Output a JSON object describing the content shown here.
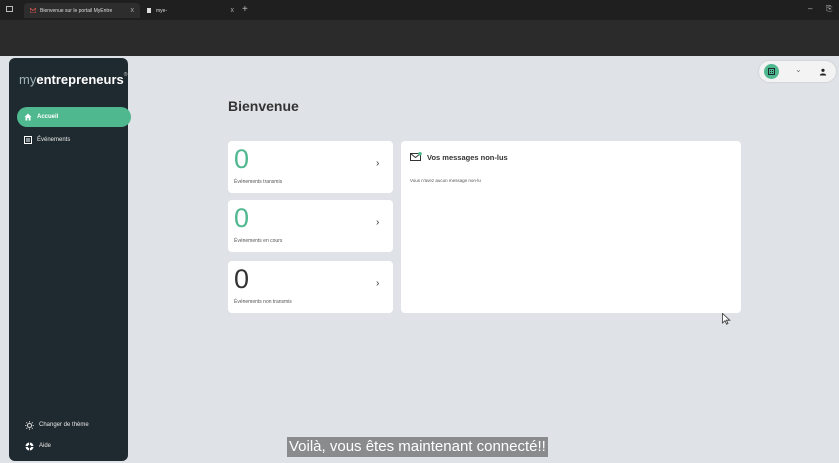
{
  "browser": {
    "tabs": [
      {
        "title": "Bienvenue sur le portail MyEntre",
        "active": true
      },
      {
        "title": "mye-",
        "active": false
      }
    ],
    "new_tab_label": "+",
    "close_label": "x",
    "minimize_label": "–",
    "restore_label": "⎘"
  },
  "brand": {
    "prefix": "my",
    "name": "entrepreneurs",
    "mark": "®"
  },
  "sidebar": {
    "items": [
      {
        "label": "Accueil",
        "icon": "home-icon",
        "active": true
      },
      {
        "label": "Événements",
        "icon": "calendar-icon",
        "active": false
      }
    ],
    "bottom": [
      {
        "label": "Changer de thème",
        "icon": "theme-icon"
      },
      {
        "label": "Aide",
        "icon": "help-icon"
      }
    ]
  },
  "header": {
    "chevron": "⌄"
  },
  "main": {
    "title": "Bienvenue",
    "stats": [
      {
        "value": "0",
        "label": "Événements transmis",
        "color": "#4fb88f"
      },
      {
        "value": "0",
        "label": "Événements en cours",
        "color": "#4fb88f"
      },
      {
        "value": "0",
        "label": "Événements non transmis",
        "color": "#333333"
      }
    ],
    "arrow": "›",
    "messages": {
      "title": "Vos messages non-lus",
      "empty": "Vous n'avez aucun message non-lu"
    }
  },
  "caption": "Voilà, vous êtes maintenant connecté!!",
  "colors": {
    "accent": "#4fb88f",
    "sidebar": "#1f2a30",
    "background": "#dfe3e7"
  }
}
